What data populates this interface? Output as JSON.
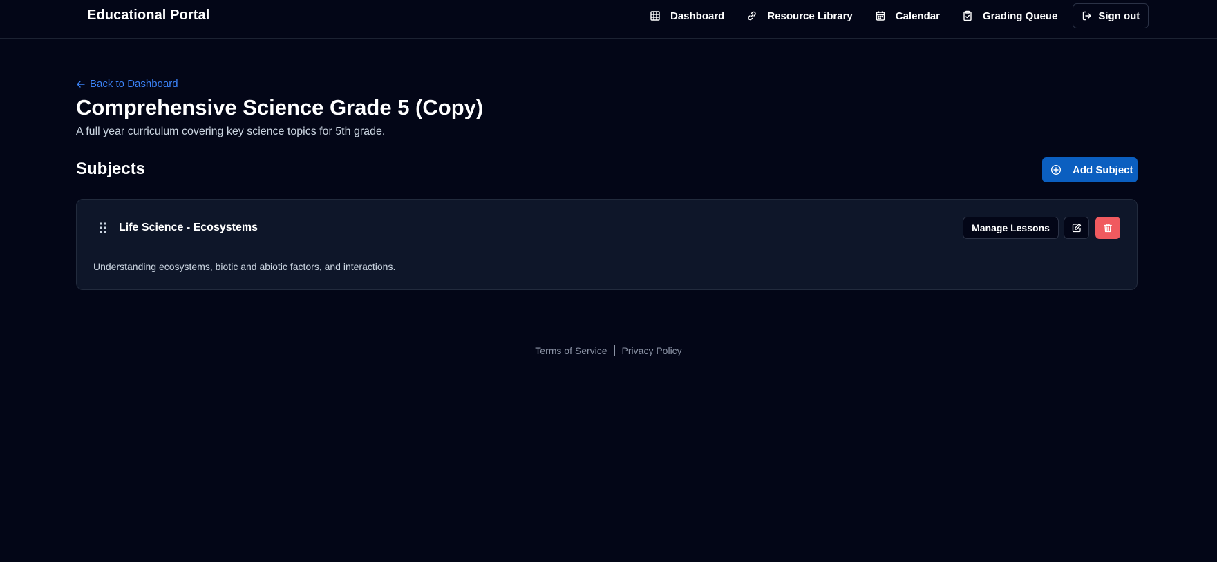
{
  "header": {
    "brand": "Educational Portal",
    "nav": [
      {
        "label": "Dashboard",
        "icon": "grid-icon"
      },
      {
        "label": "Resource Library",
        "icon": "link-icon"
      },
      {
        "label": "Calendar",
        "icon": "calendar-icon"
      },
      {
        "label": "Grading Queue",
        "icon": "clipboard-check-icon"
      }
    ],
    "signout_label": "Sign out"
  },
  "main": {
    "back_label": "Back to Dashboard",
    "title": "Comprehensive Science Grade 5 (Copy)",
    "subtitle": "A full year curriculum covering key science topics for 5th grade.",
    "section_title": "Subjects",
    "add_subject_label": "Add Subject",
    "subjects": [
      {
        "title": "Life Science - Ecosystems",
        "description": "Understanding ecosystems, biotic and abiotic factors, and interactions.",
        "manage_label": "Manage Lessons"
      }
    ]
  },
  "footer": {
    "terms_label": "Terms of Service",
    "privacy_label": "Privacy Policy"
  },
  "colors": {
    "background": "#030617",
    "accent": "#3b82f6",
    "primary_button": "#0b5fc0",
    "danger": "#f05a5f",
    "card": "#0e1629"
  }
}
